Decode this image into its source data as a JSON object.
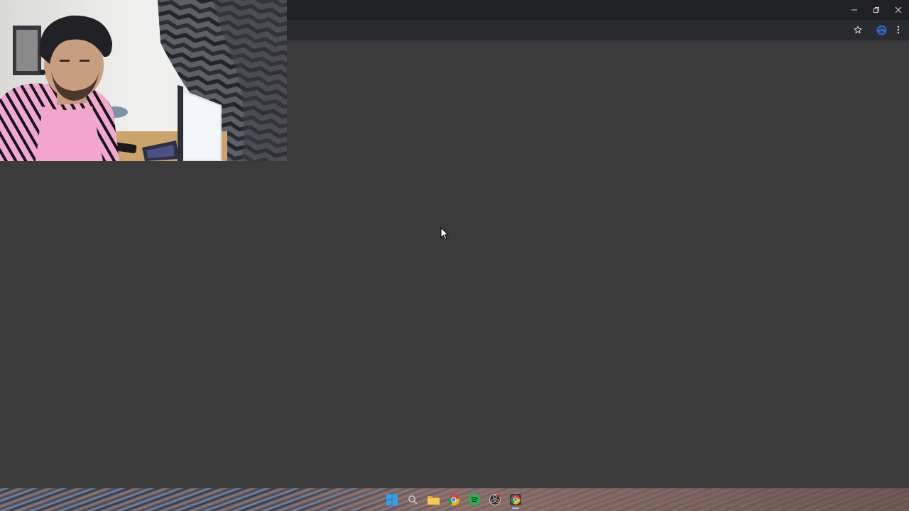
{
  "browser": {
    "toolbar": {
      "bookmark_icon": "star-icon",
      "profile_icon": "avatar",
      "menu_icon": "kebab-menu-icon"
    },
    "window_controls": [
      "minimize-icon",
      "restore-icon",
      "close-icon"
    ],
    "page_background": "#3b3b3b"
  },
  "webcam": {
    "description_icon": "webcam-feed"
  },
  "taskbar": {
    "icons": [
      {
        "name": "start-icon",
        "color": "#2aa2f0"
      },
      {
        "name": "search-icon",
        "color": "#cfcfcf"
      },
      {
        "name": "file-explorer-icon",
        "color": "#f2c03a"
      },
      {
        "name": "chrome-icon",
        "color": "#4285f4"
      },
      {
        "name": "spotify-icon",
        "color": "#1db954"
      },
      {
        "name": "obs-icon",
        "color": "#d0d0d0"
      },
      {
        "name": "chrome-active-icon",
        "color": "#4285f4"
      }
    ]
  }
}
